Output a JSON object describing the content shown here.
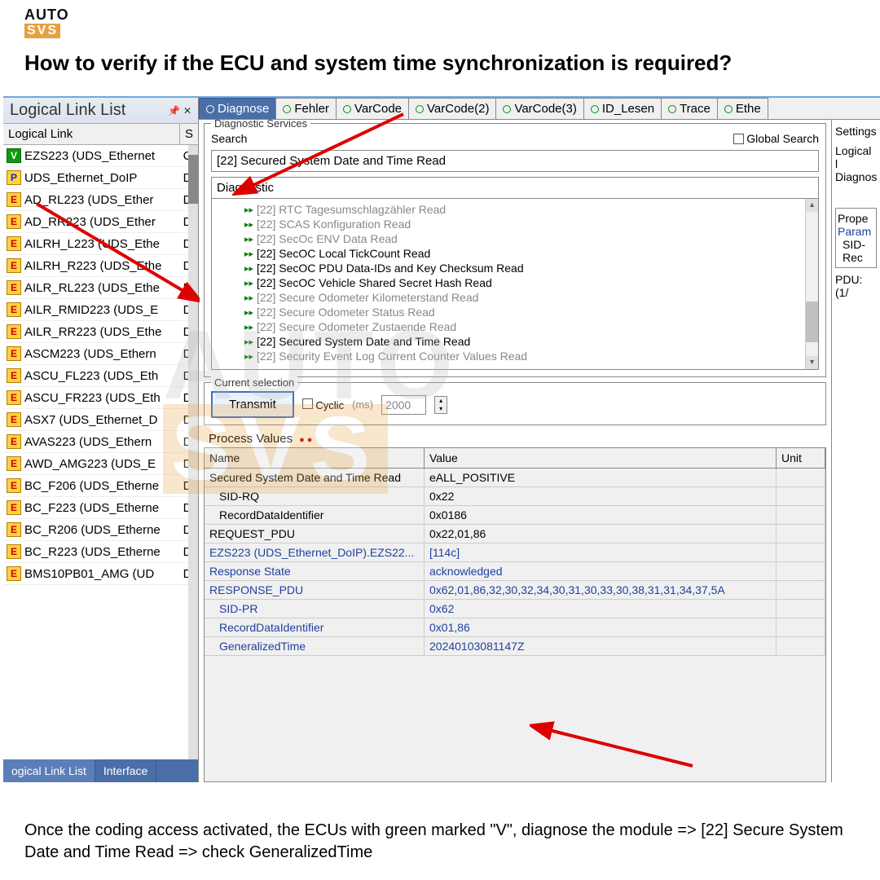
{
  "logo": {
    "top": "AUTO",
    "bottom": "SVS"
  },
  "heading": "How to verify if the ECU and system time synchronization is required?",
  "leftPanel": {
    "title": "Logical Link List",
    "col1": "Logical Link",
    "col2": "S",
    "items": [
      {
        "badge": "V",
        "name": "EZS223 (UDS_Ethernet",
        "st": "C"
      },
      {
        "badge": "P",
        "name": "UDS_Ethernet_DoIP",
        "st": "D"
      },
      {
        "badge": "E",
        "name": "AD_RL223 (UDS_Ether",
        "st": "D"
      },
      {
        "badge": "E",
        "name": "AD_RR223 (UDS_Ether",
        "st": "D"
      },
      {
        "badge": "E",
        "name": "AILRH_L223 (UDS_Ethe",
        "st": "D"
      },
      {
        "badge": "E",
        "name": "AILRH_R223 (UDS_Ethe",
        "st": "D"
      },
      {
        "badge": "E",
        "name": "AILR_RL223 (UDS_Ethe",
        "st": "D"
      },
      {
        "badge": "E",
        "name": "AILR_RMID223 (UDS_E",
        "st": "D"
      },
      {
        "badge": "E",
        "name": "AILR_RR223 (UDS_Ethe",
        "st": "D"
      },
      {
        "badge": "E",
        "name": "ASCM223 (UDS_Ethern",
        "st": "D"
      },
      {
        "badge": "E",
        "name": "ASCU_FL223 (UDS_Eth",
        "st": "D"
      },
      {
        "badge": "E",
        "name": "ASCU_FR223 (UDS_Eth",
        "st": "D"
      },
      {
        "badge": "E",
        "name": "ASX7 (UDS_Ethernet_D",
        "st": "D"
      },
      {
        "badge": "E",
        "name": "AVAS223 (UDS_Ethern",
        "st": "D"
      },
      {
        "badge": "E",
        "name": "AWD_AMG223 (UDS_E",
        "st": "D"
      },
      {
        "badge": "E",
        "name": "BC_F206 (UDS_Etherne",
        "st": "D"
      },
      {
        "badge": "E",
        "name": "BC_F223 (UDS_Etherne",
        "st": "D"
      },
      {
        "badge": "E",
        "name": "BC_R206 (UDS_Etherne",
        "st": "D"
      },
      {
        "badge": "E",
        "name": "BC_R223 (UDS_Etherne",
        "st": "D"
      },
      {
        "badge": "E",
        "name": "BMS10PB01_AMG (UD",
        "st": "D"
      }
    ],
    "tabs": [
      "ogical Link List",
      "Interface"
    ]
  },
  "topTabs": [
    "Diagnose",
    "Fehler",
    "VarCode",
    "VarCode(2)",
    "VarCode(3)",
    "ID_Lesen",
    "Trace",
    "Ethe"
  ],
  "diag": {
    "legend": "Diagnostic Services",
    "searchLbl": "Search",
    "globalSearch": "Global Search",
    "searchVal": "[22] Secured System Date and Time Read",
    "subLbl": "Diagnostic",
    "tree": [
      {
        "t": "[22] RTC Tagesumschlagzähler Read",
        "b": false
      },
      {
        "t": "[22] SCAS Konfiguration Read",
        "b": false
      },
      {
        "t": "[22] SecOc ENV Data Read",
        "b": false
      },
      {
        "t": "[22] SecOC Local TickCount Read",
        "b": true
      },
      {
        "t": "[22] SecOC PDU Data-IDs and Key Checksum Read",
        "b": true
      },
      {
        "t": "[22] SecOC Vehicle Shared Secret Hash Read",
        "b": true
      },
      {
        "t": "[22] Secure Odometer Kilometerstand Read",
        "b": false
      },
      {
        "t": "[22] Secure Odometer Status Read",
        "b": false
      },
      {
        "t": "[22] Secure Odometer Zustaende Read",
        "b": false
      },
      {
        "t": "[22] Secured System Date and Time Read",
        "b": true
      },
      {
        "t": "[22] Security Event Log Current Counter Values Read",
        "b": false
      }
    ]
  },
  "curSel": {
    "legend": "Current selection",
    "transmit": "Transmit",
    "cyclic": "Cyclic",
    "ms": "(ms)",
    "msVal": "2000"
  },
  "pv": {
    "label": "Process Values",
    "hName": "Name",
    "hVal": "Value",
    "hUnit": "Unit",
    "rows": [
      {
        "n": "Secured System Date and Time Read",
        "v": "eALL_POSITIVE",
        "blue": false,
        "indent": false
      },
      {
        "n": "SID-RQ",
        "v": "0x22",
        "blue": false,
        "indent": true
      },
      {
        "n": "RecordDataIdentifier",
        "v": "0x0186",
        "blue": false,
        "indent": true
      },
      {
        "n": "REQUEST_PDU",
        "v": "0x22,01,86",
        "blue": false,
        "indent": false
      },
      {
        "n": "EZS223 (UDS_Ethernet_DoIP).EZS22...",
        "v": "[114c]",
        "blue": true,
        "indent": false
      },
      {
        "n": "Response State",
        "v": "acknowledged",
        "blue": true,
        "indent": false
      },
      {
        "n": "RESPONSE_PDU",
        "v": "0x62,01,86,32,30,32,34,30,31,30,33,30,38,31,31,34,37,5A",
        "blue": true,
        "indent": false
      },
      {
        "n": "SID-PR",
        "v": "0x62",
        "blue": true,
        "indent": true
      },
      {
        "n": "RecordDataIdentifier",
        "v": "0x01,86",
        "blue": true,
        "indent": true
      },
      {
        "n": "GeneralizedTime",
        "v": "20240103081147Z",
        "blue": true,
        "indent": true
      }
    ]
  },
  "side": {
    "settings": "Settings",
    "logical": "Logical l",
    "diagnos": "Diagnos",
    "prope": "Prope",
    "param": "Param",
    "sid": "SID-",
    "rec": "Rec",
    "pdu": "PDU: (1/"
  },
  "footer": "Once the coding access activated, the ECUs with green marked \"V\", diagnose the module => [22] Secure System Date and Time Read => check GeneralizedTime"
}
